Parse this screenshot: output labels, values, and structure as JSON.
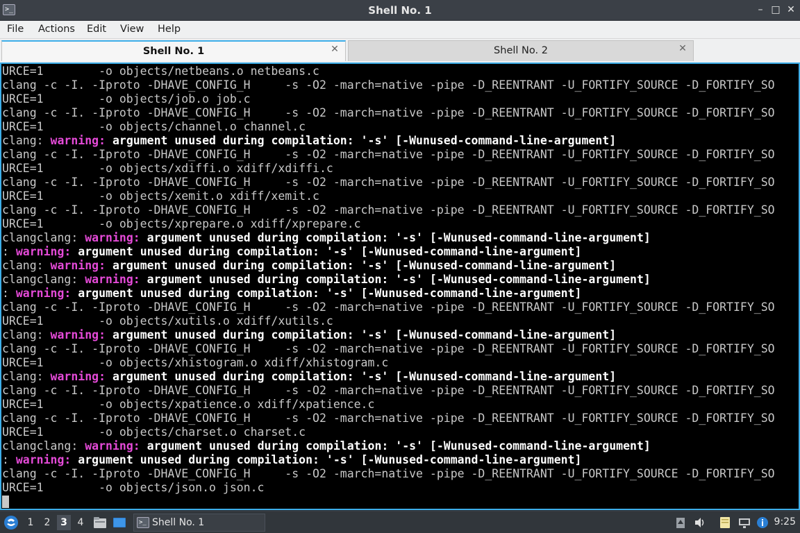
{
  "window": {
    "title": "Shell No. 1",
    "app_icon_glyph": ">_",
    "minimize_glyph": "–",
    "maximize_glyph": "□",
    "close_glyph": "✕"
  },
  "menu": {
    "items": [
      "File",
      "Actions",
      "Edit",
      "View",
      "Help"
    ]
  },
  "tabs": [
    {
      "label": "Shell No. 1",
      "active": true,
      "close_glyph": "✕"
    },
    {
      "label": "Shell No. 2",
      "active": false,
      "close_glyph": "✕"
    }
  ],
  "terminal": {
    "colors": {
      "background": "#000000",
      "text": "#c8c8c8",
      "warning": "#e54ad8",
      "bold": "#ffffff",
      "border": "#3daee9"
    },
    "lines": [
      [
        {
          "t": "URCE=1        -o objects/netbeans.o netbeans.c"
        }
      ],
      [
        {
          "t": "clang -c -I. -Iproto -DHAVE_CONFIG_H     -s -O2 -march=native -pipe -D_REENTRANT -U_FORTIFY_SOURCE -D_FORTIFY_SO"
        }
      ],
      [
        {
          "t": "URCE=1        -o objects/job.o job.c"
        }
      ],
      [
        {
          "t": "clang -c -I. -Iproto -DHAVE_CONFIG_H     -s -O2 -march=native -pipe -D_REENTRANT -U_FORTIFY_SOURCE -D_FORTIFY_SO"
        }
      ],
      [
        {
          "t": "URCE=1        -o objects/channel.o channel.c"
        }
      ],
      [
        {
          "t": "clang: "
        },
        {
          "t": "warning:",
          "s": "w"
        },
        {
          "t": " argument unused during compilation: '-s' [-Wunused-command-line-argument]",
          "s": "b"
        }
      ],
      [
        {
          "t": "clang -c -I. -Iproto -DHAVE_CONFIG_H     -s -O2 -march=native -pipe -D_REENTRANT -U_FORTIFY_SOURCE -D_FORTIFY_SO"
        }
      ],
      [
        {
          "t": "URCE=1        -o objects/xdiffi.o xdiff/xdiffi.c"
        }
      ],
      [
        {
          "t": "clang -c -I. -Iproto -DHAVE_CONFIG_H     -s -O2 -march=native -pipe -D_REENTRANT -U_FORTIFY_SOURCE -D_FORTIFY_SO"
        }
      ],
      [
        {
          "t": "URCE=1        -o objects/xemit.o xdiff/xemit.c"
        }
      ],
      [
        {
          "t": "clang -c -I. -Iproto -DHAVE_CONFIG_H     -s -O2 -march=native -pipe -D_REENTRANT -U_FORTIFY_SOURCE -D_FORTIFY_SO"
        }
      ],
      [
        {
          "t": "URCE=1        -o objects/xprepare.o xdiff/xprepare.c"
        }
      ],
      [
        {
          "t": "clangclang: "
        },
        {
          "t": "warning:",
          "s": "w"
        },
        {
          "t": " argument unused during compilation: '-s' [-Wunused-command-line-argument]",
          "s": "b"
        }
      ],
      [
        {
          "t": ": "
        },
        {
          "t": "warning:",
          "s": "w"
        },
        {
          "t": " argument unused during compilation: '-s' [-Wunused-command-line-argument]",
          "s": "b"
        }
      ],
      [
        {
          "t": "clang: "
        },
        {
          "t": "warning:",
          "s": "w"
        },
        {
          "t": " argument unused during compilation: '-s' [-Wunused-command-line-argument]",
          "s": "b"
        }
      ],
      [
        {
          "t": "clangclang: "
        },
        {
          "t": "warning:",
          "s": "w"
        },
        {
          "t": " argument unused during compilation: '-s' [-Wunused-command-line-argument]",
          "s": "b"
        }
      ],
      [
        {
          "t": ": "
        },
        {
          "t": "warning:",
          "s": "w"
        },
        {
          "t": " argument unused during compilation: '-s' [-Wunused-command-line-argument]",
          "s": "b"
        }
      ],
      [
        {
          "t": "clang -c -I. -Iproto -DHAVE_CONFIG_H     -s -O2 -march=native -pipe -D_REENTRANT -U_FORTIFY_SOURCE -D_FORTIFY_SO"
        }
      ],
      [
        {
          "t": "URCE=1        -o objects/xutils.o xdiff/xutils.c"
        }
      ],
      [
        {
          "t": "clang: "
        },
        {
          "t": "warning:",
          "s": "w"
        },
        {
          "t": " argument unused during compilation: '-s' [-Wunused-command-line-argument]",
          "s": "b"
        }
      ],
      [
        {
          "t": "clang -c -I. -Iproto -DHAVE_CONFIG_H     -s -O2 -march=native -pipe -D_REENTRANT -U_FORTIFY_SOURCE -D_FORTIFY_SO"
        }
      ],
      [
        {
          "t": "URCE=1        -o objects/xhistogram.o xdiff/xhistogram.c"
        }
      ],
      [
        {
          "t": "clang: "
        },
        {
          "t": "warning:",
          "s": "w"
        },
        {
          "t": " argument unused during compilation: '-s' [-Wunused-command-line-argument]",
          "s": "b"
        }
      ],
      [
        {
          "t": "clang -c -I. -Iproto -DHAVE_CONFIG_H     -s -O2 -march=native -pipe -D_REENTRANT -U_FORTIFY_SOURCE -D_FORTIFY_SO"
        }
      ],
      [
        {
          "t": "URCE=1        -o objects/xpatience.o xdiff/xpatience.c"
        }
      ],
      [
        {
          "t": "clang -c -I. -Iproto -DHAVE_CONFIG_H     -s -O2 -march=native -pipe -D_REENTRANT -U_FORTIFY_SOURCE -D_FORTIFY_SO"
        }
      ],
      [
        {
          "t": "URCE=1        -o objects/charset.o charset.c"
        }
      ],
      [
        {
          "t": "clangclang: "
        },
        {
          "t": "warning:",
          "s": "w"
        },
        {
          "t": " argument unused during compilation: '-s' [-Wunused-command-line-argument]",
          "s": "b"
        }
      ],
      [
        {
          "t": ": "
        },
        {
          "t": "warning:",
          "s": "w"
        },
        {
          "t": " argument unused during compilation: '-s' [-Wunused-command-line-argument]",
          "s": "b"
        }
      ],
      [
        {
          "t": "clang -c -I. -Iproto -DHAVE_CONFIG_H     -s -O2 -march=native -pipe -D_REENTRANT -U_FORTIFY_SOURCE -D_FORTIFY_SO"
        }
      ],
      [
        {
          "t": "URCE=1        -o objects/json.o json.c"
        }
      ]
    ]
  },
  "taskbar": {
    "start_icon": "start-menu-icon",
    "workspaces": [
      {
        "label": "1",
        "active": false
      },
      {
        "label": "2",
        "active": false
      },
      {
        "label": "3",
        "active": true
      },
      {
        "label": "4",
        "active": false
      }
    ],
    "launchers": [
      "file-manager-icon",
      "desktop-icon"
    ],
    "task": {
      "label": "Shell No. 1",
      "icon_glyph": ">_"
    },
    "tray_icons": [
      "clipboard-icon",
      "volume-icon",
      "notes-icon",
      "network-icon"
    ],
    "clock": "9:25"
  }
}
